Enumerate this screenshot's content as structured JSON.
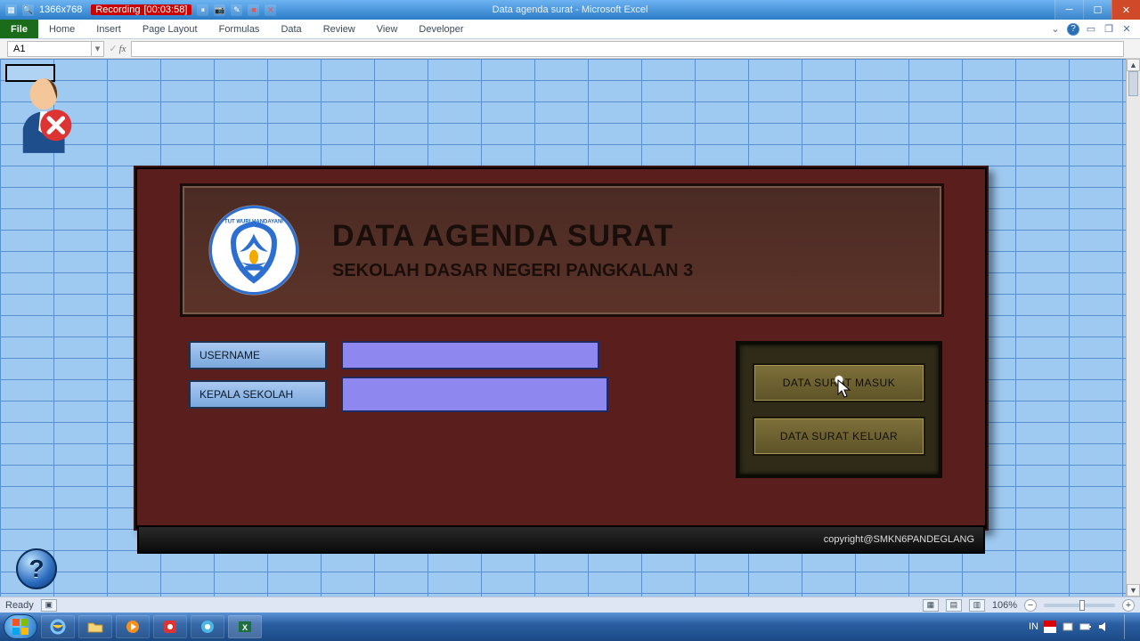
{
  "titlebar": {
    "resolution": "1366x768",
    "recording_label": "Recording",
    "recording_time": "[00:03:58]",
    "doc_title": "Data agenda surat  -  Microsoft Excel"
  },
  "ribbon": {
    "file": "File",
    "tabs": [
      "Home",
      "Insert",
      "Page Layout",
      "Formulas",
      "Data",
      "Review",
      "View",
      "Developer"
    ]
  },
  "formula_bar": {
    "cell_ref": "A1",
    "fx_label": "fx",
    "formula": ""
  },
  "userform": {
    "logo_top_text": "TUT WURI HANDAYANI",
    "title": "DATA AGENDA SURAT",
    "subtitle": "SEKOLAH DASAR NEGERI PANGKALAN 3",
    "label_username": "USERNAME",
    "label_kepala": "KEPALA SEKOLAH",
    "input_username": "",
    "input_kepala": "",
    "btn_masuk": "DATA SURAT MASUK",
    "btn_keluar": "DATA SURAT KELUAR",
    "footer": "copyright@SMKN6PANDEGLANG"
  },
  "statusbar": {
    "ready": "Ready",
    "zoom": "106%"
  },
  "taskbar": {
    "lang": "IN",
    "clock": ""
  }
}
